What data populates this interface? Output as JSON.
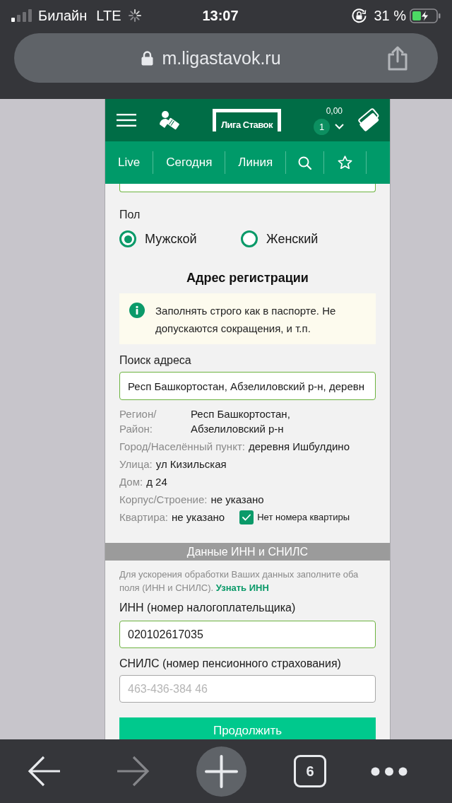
{
  "status_bar": {
    "carrier": "Билайн",
    "network": "LTE",
    "time": "13:07",
    "battery": "31 %"
  },
  "address_bar": {
    "url": "m.ligastavok.ru"
  },
  "header": {
    "logo": "Лига Ставок",
    "balance": "0,00",
    "bet_count": "1"
  },
  "nav_tabs": [
    {
      "label": "Live"
    },
    {
      "label": "Сегодня"
    },
    {
      "label": "Линия"
    }
  ],
  "form": {
    "gender": {
      "label": "Пол",
      "options": [
        {
          "label": "Мужской",
          "selected": true
        },
        {
          "label": "Женский",
          "selected": false
        }
      ]
    },
    "address_title": "Адрес регистрации",
    "notice": "Заполнять строго как в паспорте. Не допускаются сокращения, и т.п.",
    "address_search": {
      "label": "Поиск адреса",
      "value": "Респ Башкортостан, Абзелиловский р-н, деревн"
    },
    "address_details": [
      {
        "kind": "stacked",
        "label": "Регион/ Район:",
        "value": "Респ Башкортостан, Абзелиловский р-н"
      },
      {
        "kind": "inline",
        "label": "Город/Населённый пункт:",
        "value": "деревня Ишбулдино"
      },
      {
        "kind": "inline",
        "label": "Улица:",
        "value": "ул Кизильская"
      },
      {
        "kind": "inline",
        "label": "Дом:",
        "value": "д 24"
      },
      {
        "kind": "inline",
        "label": "Корпус/Строение:",
        "value": "не указано"
      },
      {
        "kind": "inline",
        "label": "Квартира:",
        "value": "не указано"
      }
    ],
    "no_apartment": {
      "label": "Нет номера квартиры",
      "checked": true
    }
  },
  "tax_section": {
    "title": "Данные ИНН и СНИЛС",
    "hint": "Для ускорения обработки Ваших данных заполните оба поля (ИНН и СНИЛС).",
    "link": "Узнать ИНН",
    "inn": {
      "label": "ИНН (номер налогоплательщика)",
      "value": "020102617035"
    },
    "snils": {
      "label": "СНИЛС (номер пенсионного страхования)",
      "placeholder": "463-436-384 46"
    }
  },
  "continue_button": "Продолжить",
  "browser_toolbar": {
    "back": {
      "disabled": false
    },
    "forward": {
      "disabled": true
    },
    "tab_count": "6"
  }
}
